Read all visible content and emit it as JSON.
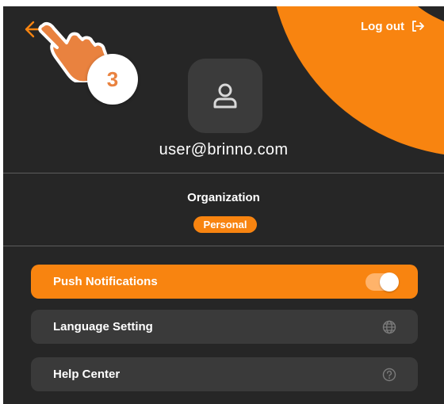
{
  "header": {
    "logout_label": "Log out"
  },
  "tutorial": {
    "step_number": "3"
  },
  "profile": {
    "email": "user@brinno.com"
  },
  "organization": {
    "title": "Organization",
    "badge": "Personal"
  },
  "menu": {
    "items": [
      {
        "label": "Push Notifications",
        "icon": "toggle-switch",
        "enabled": true
      },
      {
        "label": "Language Setting",
        "icon": "globe-icon"
      },
      {
        "label": "Help Center",
        "icon": "question-icon"
      }
    ]
  },
  "colors": {
    "accent": "#f88410",
    "background": "#262626",
    "card": "#3a3a3a"
  }
}
